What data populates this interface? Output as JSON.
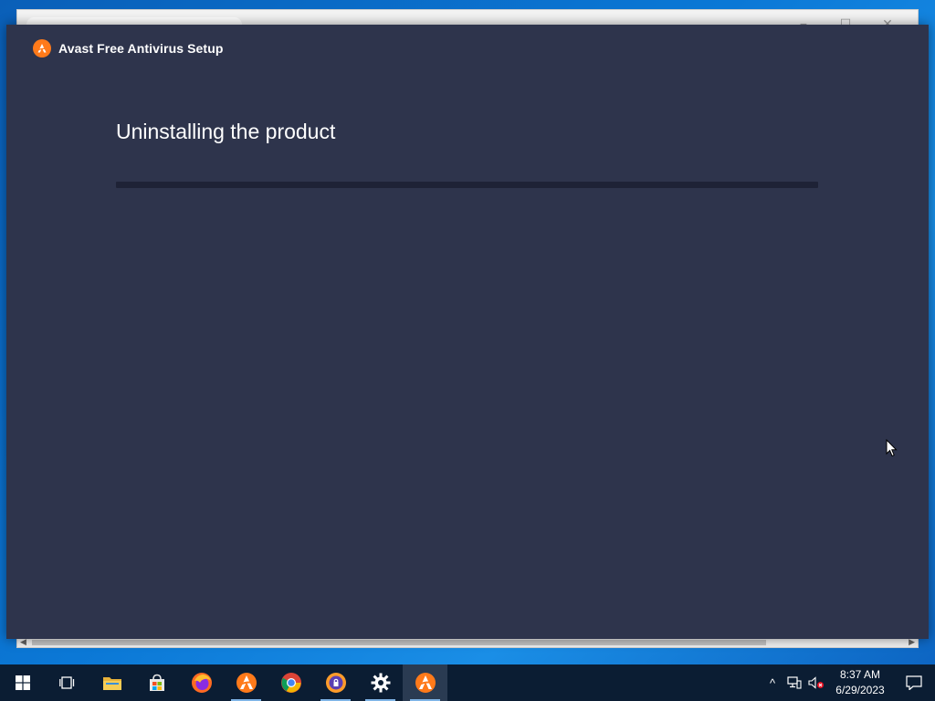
{
  "installer": {
    "app_title": "Avast Free Antivirus Setup",
    "heading": "Uninstalling the product",
    "progress": 0,
    "accent_color": "#ff7a1a",
    "background_color": "#2e344c"
  },
  "background_window": {
    "controls": [
      "−",
      "☐",
      "✕"
    ]
  },
  "taskbar": {
    "apps": [
      {
        "name": "start-button",
        "icon": "windows-logo-icon",
        "running": false
      },
      {
        "name": "task-view-button",
        "icon": "task-view-icon",
        "running": false
      },
      {
        "name": "file-explorer-button",
        "icon": "folder-icon",
        "running": false
      },
      {
        "name": "microsoft-store-button",
        "icon": "store-icon",
        "running": false
      },
      {
        "name": "firefox-button",
        "icon": "firefox-icon",
        "running": false
      },
      {
        "name": "avast-button",
        "icon": "avast-icon",
        "running": true
      },
      {
        "name": "chrome-button",
        "icon": "chrome-icon",
        "running": false
      },
      {
        "name": "avast-secure-browser-button",
        "icon": "avast-secure-browser-icon",
        "running": true
      },
      {
        "name": "settings-button",
        "icon": "gear-icon",
        "running": true
      },
      {
        "name": "avast-setup-button",
        "icon": "avast-icon",
        "running": true,
        "active": true
      }
    ],
    "tray": {
      "chevron": "^",
      "time": "8:37 AM",
      "date": "6/29/2023"
    }
  }
}
